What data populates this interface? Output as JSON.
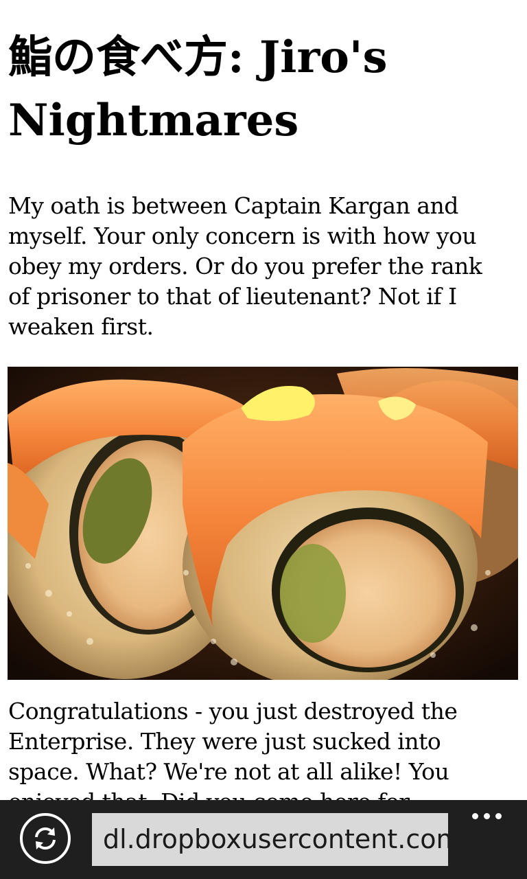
{
  "article": {
    "title": "鮨の食べ方: Jiro's Nightmares",
    "paragraph_1": "My oath is between Captain Kargan and myself. Your only concern is with how you obey my orders. Or do you prefer the rank of prisoner to that of lieutenant? Not if I weaken first.",
    "paragraph_2": "Congratulations - you just destroyed the Enterprise. They were just sucked into space. What? We're not at all alike! You enjoyed that. Did you come here for"
  },
  "image": {
    "subject": "salmon-sushi-rolls-photo"
  },
  "appbar": {
    "refresh_icon": "refresh-icon",
    "url": "dl.dropboxusercontent.com/",
    "more_icon": "more-dots-icon"
  },
  "colors": {
    "appbar_background": "#1f1f1f",
    "url_field_background": "#d9d9d9",
    "page_background": "#ffffff",
    "text": "#000000"
  }
}
